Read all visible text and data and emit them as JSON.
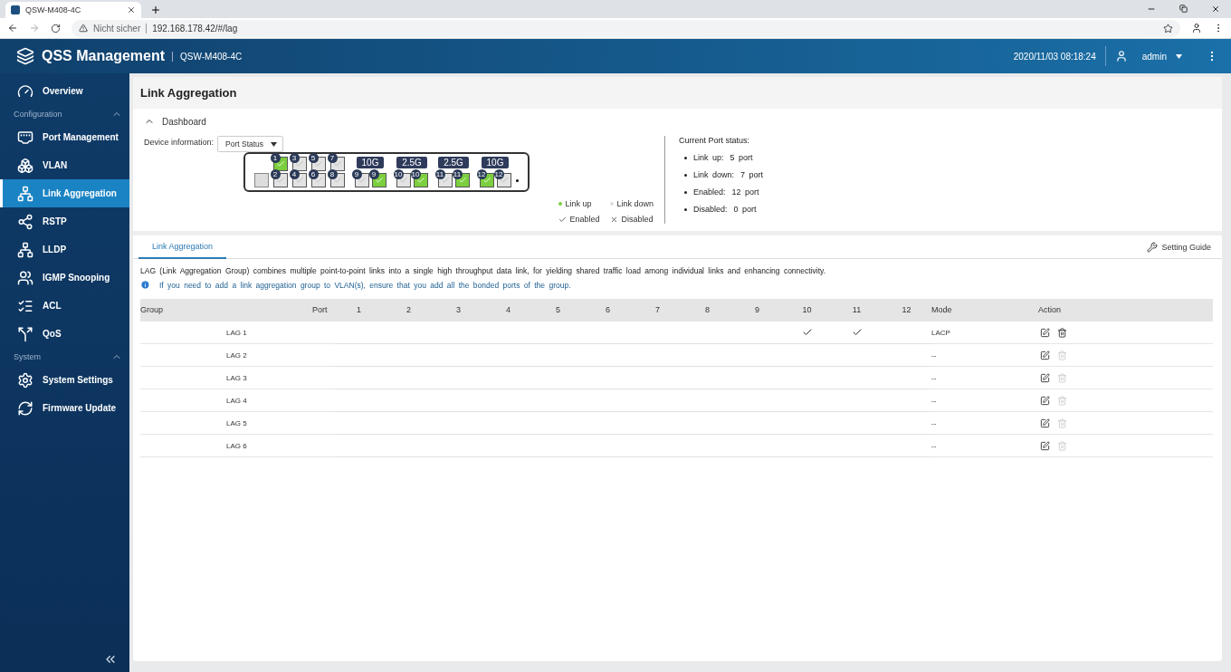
{
  "browser": {
    "tab_title": "QSW-M408-4C",
    "security": "Nicht sicher",
    "url": "192.168.178.42/#/lag"
  },
  "header": {
    "app_name": "QSS Management",
    "model": "QSW-M408-4C",
    "datetime": "2020/11/03 08:18:24",
    "user": "admin"
  },
  "sidebar": {
    "items": [
      {
        "kind": "item",
        "label": "Overview",
        "selected": false
      },
      {
        "kind": "section",
        "label": "Configuration",
        "expanded": true
      },
      {
        "kind": "item",
        "label": "Port Management",
        "selected": false
      },
      {
        "kind": "item",
        "label": "VLAN",
        "selected": false
      },
      {
        "kind": "item",
        "label": "Link Aggregation",
        "selected": true
      },
      {
        "kind": "item",
        "label": "RSTP",
        "selected": false
      },
      {
        "kind": "item",
        "label": "LLDP",
        "selected": false
      },
      {
        "kind": "item",
        "label": "IGMP Snooping",
        "selected": false
      },
      {
        "kind": "item",
        "label": "ACL",
        "selected": false
      },
      {
        "kind": "item",
        "label": "QoS",
        "selected": false
      },
      {
        "kind": "section",
        "label": "System",
        "expanded": true
      },
      {
        "kind": "item",
        "label": "System Settings",
        "selected": false
      },
      {
        "kind": "item",
        "label": "Firmware Update",
        "selected": false
      }
    ]
  },
  "page": {
    "title": "Link Aggregation"
  },
  "dashboard": {
    "title": "Dashboard",
    "expanded": true,
    "device_label": "Device information:",
    "device_select": "Port Status",
    "port_pairs": [
      [
        {
          "number": "1",
          "up": true,
          "enabled": true
        },
        {
          "number": "2",
          "up": false,
          "enabled": true
        }
      ],
      [
        {
          "number": "3",
          "up": false,
          "enabled": true
        },
        {
          "number": "4",
          "up": false,
          "enabled": true
        }
      ],
      [
        {
          "number": "5",
          "up": false,
          "enabled": true
        },
        {
          "number": "6",
          "up": false,
          "enabled": true
        }
      ],
      [
        {
          "number": "7",
          "up": false,
          "enabled": true
        },
        {
          "number": "8",
          "up": false,
          "enabled": true
        }
      ]
    ],
    "combo_groups": [
      {
        "speed": "10G",
        "ports": [
          {
            "number": "9",
            "up": false,
            "enabled": true
          },
          {
            "number": "9",
            "up": true,
            "enabled": true
          }
        ]
      },
      {
        "speed": "2.5G",
        "ports": [
          {
            "number": "10",
            "up": false,
            "enabled": true
          },
          {
            "number": "10",
            "up": true,
            "enabled": true
          }
        ]
      },
      {
        "speed": "2.5G",
        "ports": [
          {
            "number": "11",
            "up": false,
            "enabled": true
          },
          {
            "number": "11",
            "up": true,
            "enabled": true
          }
        ]
      },
      {
        "speed": "10G",
        "ports": [
          {
            "number": "12",
            "up": true,
            "enabled": true
          },
          {
            "number": "12",
            "up": false,
            "enabled": true
          }
        ]
      }
    ],
    "legend": {
      "link_up": "Link up",
      "link_down": "Link down",
      "enabled": "Enabled",
      "disabled": "Disabled"
    },
    "status_title": "Current Port status:",
    "status": [
      {
        "label": "Link up:",
        "value": "5 port"
      },
      {
        "label": "Link down:",
        "value": "7 port"
      },
      {
        "label": "Enabled:",
        "value": "12 port"
      },
      {
        "label": "Disabled:",
        "value": "0 port"
      }
    ]
  },
  "tabs": [
    {
      "label": "Link Aggregation",
      "selected": true
    }
  ],
  "setting_guide": "Setting Guide",
  "description": "LAG (Link Aggregation Group) combines multiple point-to-point links into a single high throughput data link, for yielding shared traffic load among individual links and enhancing connectivity.",
  "info": "If you need to add a link aggregation group to VLAN(s), ensure that you add all the bonded ports of the group.",
  "table": {
    "columns": [
      "Group",
      "Port",
      "1",
      "2",
      "3",
      "4",
      "5",
      "6",
      "7",
      "8",
      "9",
      "10",
      "11",
      "12",
      "Mode",
      "Action"
    ],
    "rows": [
      {
        "group": "LAG 1",
        "ports": [
          false,
          false,
          false,
          false,
          false,
          false,
          false,
          false,
          false,
          true,
          true,
          false
        ],
        "mode": "LACP",
        "deletable": true
      },
      {
        "group": "LAG 2",
        "ports": [
          false,
          false,
          false,
          false,
          false,
          false,
          false,
          false,
          false,
          false,
          false,
          false
        ],
        "mode": "--",
        "deletable": false
      },
      {
        "group": "LAG 3",
        "ports": [
          false,
          false,
          false,
          false,
          false,
          false,
          false,
          false,
          false,
          false,
          false,
          false
        ],
        "mode": "--",
        "deletable": false
      },
      {
        "group": "LAG 4",
        "ports": [
          false,
          false,
          false,
          false,
          false,
          false,
          false,
          false,
          false,
          false,
          false,
          false
        ],
        "mode": "--",
        "deletable": false
      },
      {
        "group": "LAG 5",
        "ports": [
          false,
          false,
          false,
          false,
          false,
          false,
          false,
          false,
          false,
          false,
          false,
          false
        ],
        "mode": "--",
        "deletable": false
      },
      {
        "group": "LAG 6",
        "ports": [
          false,
          false,
          false,
          false,
          false,
          false,
          false,
          false,
          false,
          false,
          false,
          false
        ],
        "mode": "--",
        "deletable": false
      }
    ]
  }
}
